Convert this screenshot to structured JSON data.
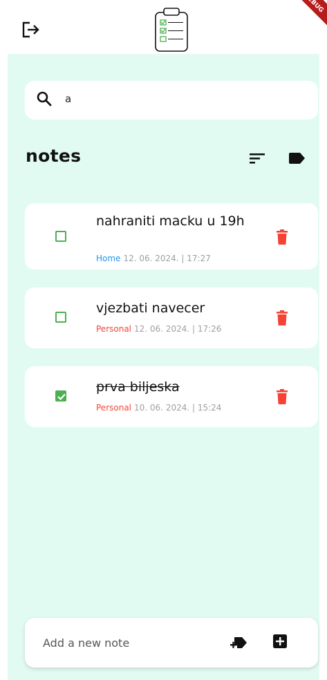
{
  "app": {
    "debug_banner": "DEBUG",
    "icons": {
      "logout": "logout-icon",
      "logo": "checklist-clipboard-icon",
      "sort": "sort-icon",
      "label": "label-icon",
      "delete": "trash-icon",
      "new_label": "new-label-icon",
      "add": "add-box-icon",
      "search": "search-icon"
    }
  },
  "search": {
    "value": "a"
  },
  "page_title": "notes",
  "notes": [
    {
      "text": "nahraniti macku u 19h",
      "category": "Home",
      "date": "12. 06. 2024. | 17:27",
      "done": false
    },
    {
      "text": "vjezbati navecer",
      "category": "Personal",
      "date": "12. 06. 2024. | 17:26",
      "done": false
    },
    {
      "text": "prva biljeska",
      "category": "Personal",
      "date": "10. 06. 2024. | 15:24",
      "done": true
    }
  ],
  "new_note": {
    "placeholder": "Add a new note",
    "value": ""
  },
  "colors": {
    "background": "#e2fbf2",
    "check_green": "#4caf50",
    "delete_red": "#f44336",
    "home_blue": "#2196f3",
    "personal_red": "#f44336",
    "date_grey": "#9e9e9e"
  }
}
